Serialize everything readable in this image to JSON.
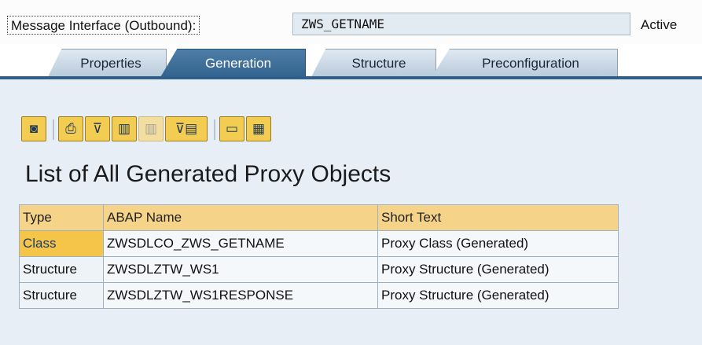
{
  "header": {
    "label": "Message Interface (Outbound):",
    "value": "ZWS_GETNAME",
    "status": "Active"
  },
  "tabs": [
    {
      "label": "Properties",
      "active": false
    },
    {
      "label": "Generation",
      "active": true
    },
    {
      "label": "Structure",
      "active": false
    },
    {
      "label": "Preconfiguration",
      "active": false
    }
  ],
  "toolbar": {
    "buttons": [
      {
        "icon": "details-icon",
        "glyph": "◙"
      },
      {
        "icon": "print-icon",
        "glyph": "⎙"
      },
      {
        "icon": "filter-icon",
        "glyph": "⊽"
      },
      {
        "icon": "find-icon",
        "glyph": "▥"
      },
      {
        "icon": "find-next-icon",
        "glyph": "▥"
      },
      {
        "icon": "set-filter-icon",
        "glyph": "⊽▤"
      },
      {
        "icon": "layout-icon",
        "glyph": "▭"
      },
      {
        "icon": "grid-icon",
        "glyph": "▦"
      }
    ]
  },
  "list": {
    "title": "List of All Generated Proxy Objects",
    "columns": [
      "Type",
      "ABAP Name",
      "Short Text"
    ],
    "rows": [
      {
        "type": "Class",
        "name": "ZWSDLCO_ZWS_GETNAME",
        "text": "Proxy Class (Generated)"
      },
      {
        "type": "Structure",
        "name": "ZWSDLZTW_WS1",
        "text": "Proxy Structure (Generated)"
      },
      {
        "type": "Structure",
        "name": "ZWSDLZTW_WS1RESPONSE",
        "text": "Proxy Structure (Generated)"
      }
    ]
  },
  "colors": {
    "active_tab": "#3a6c97",
    "inactive_tab": "#c9d8e6",
    "header_row": "#f5d48a",
    "selected_cell": "#f5c54a",
    "panel": "#e7eef5"
  }
}
